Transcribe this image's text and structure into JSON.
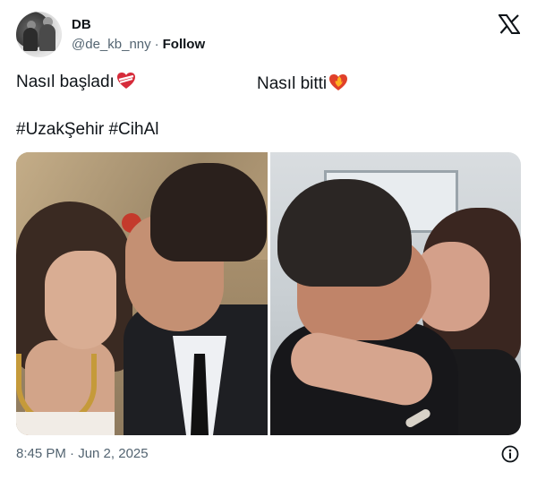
{
  "author": {
    "name": "DB",
    "handle": "@de_kb_nny",
    "separator": "·",
    "follow_label": "Follow"
  },
  "tweet": {
    "line_left": "Nasıl başladı",
    "line_right": "Nasıl bitti",
    "hashtags": "#UzakŞehir #CihAl",
    "left_emoji": "heart-with-ribbon-icon",
    "right_emoji": "heart-on-fire-icon"
  },
  "media": {
    "images": [
      "photo-before",
      "photo-after"
    ]
  },
  "footer": {
    "timestamp": "8:45 PM · Jun 2, 2025"
  },
  "colors": {
    "text": "#0f1419",
    "secondary": "#536471",
    "accent": "#1d9bf0"
  }
}
